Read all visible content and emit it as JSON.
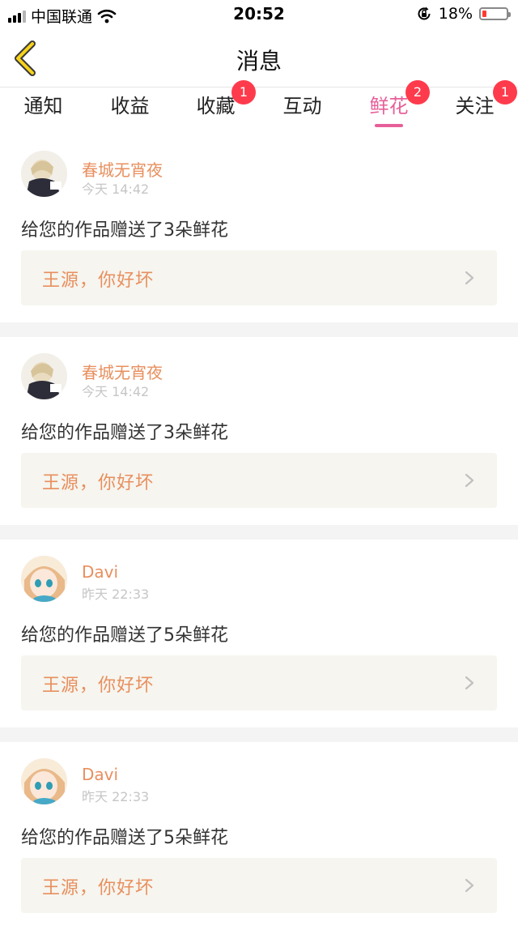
{
  "status_bar": {
    "carrier": "中国联通",
    "time": "20:52",
    "battery_text": "18%",
    "battery_level": 0.18,
    "battery_color": "#ff3b30"
  },
  "nav": {
    "back_icon": "chevron-left-icon",
    "title": "消息"
  },
  "tabs": [
    {
      "label": "通知",
      "badge": "",
      "active": false
    },
    {
      "label": "收益",
      "badge": "",
      "active": false
    },
    {
      "label": "收藏",
      "badge": "1",
      "active": false
    },
    {
      "label": "互动",
      "badge": "",
      "active": false
    },
    {
      "label": "鲜花",
      "badge": "2",
      "active": true
    },
    {
      "label": "关注",
      "badge": "1",
      "active": false
    }
  ],
  "accent_color": "#e75f98",
  "name_color": "#e88f5e",
  "messages": [
    {
      "username": "春城无宵夜",
      "time": "今天 14:42",
      "text": "给您的作品赠送了3朵鲜花",
      "work_title": "王源，你好坏"
    },
    {
      "username": "春城无宵夜",
      "time": "今天 14:42",
      "text": "给您的作品赠送了3朵鲜花",
      "work_title": "王源，你好坏"
    },
    {
      "username": "Davi",
      "time": "昨天 22:33",
      "text": "给您的作品赠送了5朵鲜花",
      "work_title": "王源，你好坏"
    },
    {
      "username": "Davi",
      "time": "昨天 22:33",
      "text": "给您的作品赠送了5朵鲜花",
      "work_title": "王源，你好坏"
    }
  ]
}
